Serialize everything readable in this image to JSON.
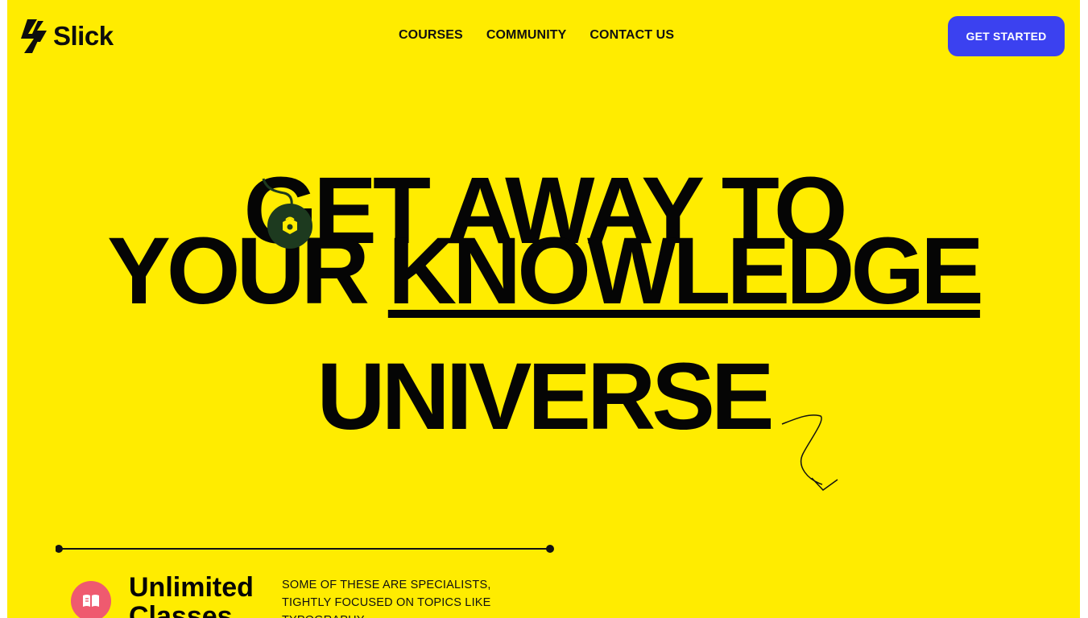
{
  "brand": {
    "name": "Slick"
  },
  "nav": {
    "items": [
      {
        "label": "COURSES"
      },
      {
        "label": "COMMUNITY"
      },
      {
        "label": "CONTACT US"
      }
    ],
    "cta_label": "GET STARTED"
  },
  "hero": {
    "line1": "GET AWAY TO",
    "line2_plain": "YOUR ",
    "line2_highlight": "KNOWLEDGE",
    "line3": "UNIVERSE"
  },
  "feature": {
    "title": "Unlimited Classes",
    "description": "SOME OF THESE ARE SPECIALISTS, TIGHTLY FOCUSED ON TOPICS LIKE TYPOGRAPHY"
  },
  "icons": {
    "logo": "bolt-icon",
    "badge": "badge-icon",
    "feature": "book-icon",
    "arrow": "squiggle-arrow-icon"
  },
  "colors": {
    "background": "#ffec00",
    "cta": "#3b41f0",
    "text": "#050505",
    "badge": "#1d3a1f",
    "feature_icon": "#ef5a6f"
  }
}
